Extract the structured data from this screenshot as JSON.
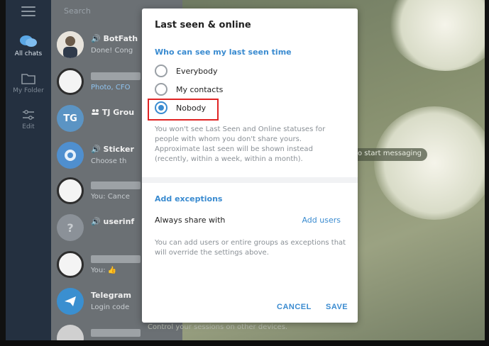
{
  "sidebar": {
    "items": [
      {
        "label": "All chats",
        "icon": "chat-bubbles-icon"
      },
      {
        "label": "My Folder",
        "icon": "folder-icon"
      },
      {
        "label": "Edit",
        "icon": "sliders-icon"
      }
    ]
  },
  "chatlist": {
    "search_placeholder": "Search",
    "chats": [
      {
        "title": "BotFath",
        "sub": "Done! Cong",
        "avatar": "bot-icon"
      },
      {
        "title": "",
        "sub": "Photo, CFO",
        "avatar": "ring"
      },
      {
        "title": "TJ Grou",
        "sub": "",
        "avatar_text": "TG"
      },
      {
        "title": "Sticker",
        "sub": "Choose th",
        "avatar": "sticker-icon"
      },
      {
        "title": "",
        "sub": "You: Cance",
        "avatar": "ring"
      },
      {
        "title": "userinf",
        "sub": "",
        "avatar": "user-icon"
      },
      {
        "title": "",
        "sub": "You: 👍",
        "avatar": "ring"
      },
      {
        "title": "Telegram",
        "sub": "Login code",
        "avatar": "paper-plane-icon"
      }
    ]
  },
  "chatarea": {
    "hint": "o start messaging",
    "bottom_hint": "Control your sessions on other devices."
  },
  "dialog": {
    "title": "Last seen & online",
    "section_title": "Who can see my last seen time",
    "options": [
      "Everybody",
      "My contacts",
      "Nobody"
    ],
    "selected": "Nobody",
    "description": "You won't see Last Seen and Online statuses for people with whom you don't share yours. Approximate last seen will be shown instead (recently, within a week, within a month).",
    "exceptions_title": "Add exceptions",
    "always_share_label": "Always share with",
    "add_users_label": "Add users",
    "exceptions_desc": "You can add users or entire groups as exceptions that will override the settings above.",
    "cancel_label": "CANCEL",
    "save_label": "SAVE"
  },
  "colors": {
    "accent": "#3a8bd0",
    "highlight": "#e02424"
  }
}
